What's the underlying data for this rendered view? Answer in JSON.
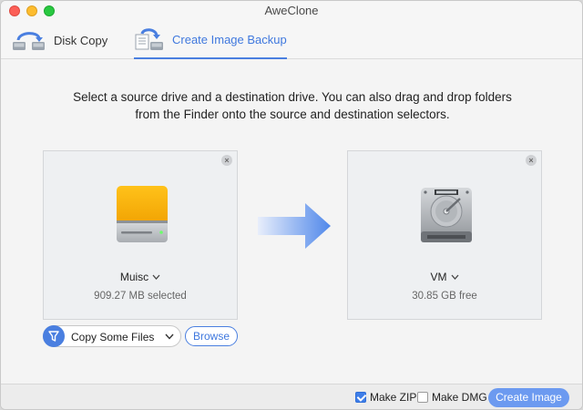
{
  "window": {
    "title": "AweClone"
  },
  "tabs": [
    {
      "label": "Disk Copy",
      "icon": "disk-copy-icon",
      "active": false
    },
    {
      "label": "Create Image Backup",
      "icon": "image-backup-icon",
      "active": true
    }
  ],
  "instructions": {
    "line1": "Select a source drive and a destination drive. You can also drag and drop folders",
    "line2": "from the Finder onto the source and destination selectors."
  },
  "source": {
    "name": "Muisc",
    "info": "909.27 MB selected",
    "icon": "external-drive-icon",
    "accent": "#f5a800"
  },
  "destination": {
    "name": "VM",
    "info": "30.85 GB free",
    "icon": "hard-disk-icon"
  },
  "filter": {
    "label": "Copy Some Files",
    "icon": "filter-icon"
  },
  "browse_label": "Browse",
  "options": {
    "make_zip": {
      "label": "Make ZIP",
      "checked": true
    },
    "make_dmg": {
      "label": "Make DMG",
      "checked": false
    }
  },
  "create_label": "Create Image",
  "colors": {
    "accent": "#4a7fe0"
  }
}
